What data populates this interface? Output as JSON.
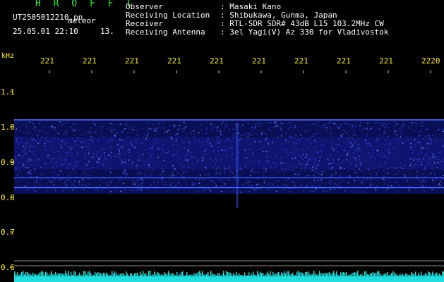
{
  "header": {
    "title": "H R O F F T",
    "file_name": "UT2505012210.pn",
    "file_type": "meteor",
    "datetime": "25.05.01 22:10",
    "datetime_extra": "13.",
    "fields": [
      {
        "label": "Observer",
        "value": ": Masaki Kano"
      },
      {
        "label": "Receiving Location",
        "value": ": Shibukawa, Gunma, Japan"
      },
      {
        "label": "Receiver",
        "value": ": RTL-SDR SDR# 43dB L15 103.2MHz CW"
      },
      {
        "label": "Receiving Antenna",
        "value": ": 3el Yagi(V) Az 330 for Vladivostok"
      }
    ]
  },
  "axes": {
    "y_unit": "kHz",
    "x_ticks": [
      "221",
      "221",
      "221",
      "221",
      "221",
      "221",
      "221",
      "221",
      "221",
      "2220"
    ],
    "y_ticks": [
      "1.1",
      "1.0",
      "0.9",
      "0.8",
      "0.7",
      "0.6"
    ]
  },
  "colors": {
    "title": "#33ee33",
    "axis_text": "#ffee33",
    "header_text": "#ffffff",
    "signal": "#3344ff",
    "noise_floor": "#22dddd"
  }
}
